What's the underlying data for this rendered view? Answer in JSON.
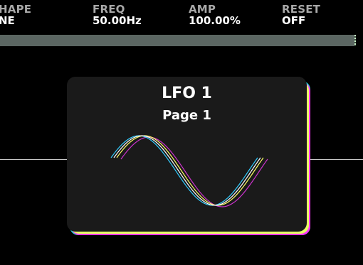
{
  "params": [
    {
      "label": "HAPE",
      "value": "NE"
    },
    {
      "label": "FREQ",
      "value": "50.00Hz"
    },
    {
      "label": "AMP",
      "value": "100.00%"
    },
    {
      "label": "RESET",
      "value": "OFF"
    }
  ],
  "card": {
    "title": "LFO 1",
    "subtitle": "Page 1"
  },
  "waveform": {
    "type": "sine",
    "cycles": 1,
    "colors": {
      "white": "#ffffff",
      "cyan": "#33ccff",
      "yellow": "#ffff66",
      "magenta": "#cc33cc"
    }
  },
  "colors": {
    "background": "#000000",
    "label": "#a8a8a8",
    "value": "#ffffff",
    "bar": "#5b6662",
    "card": "#1a1a1a",
    "card_edge_cyan": "#1fd9d9",
    "card_edge_magenta": "#ff33ff",
    "card_edge_yellow": "#e6ff66"
  }
}
